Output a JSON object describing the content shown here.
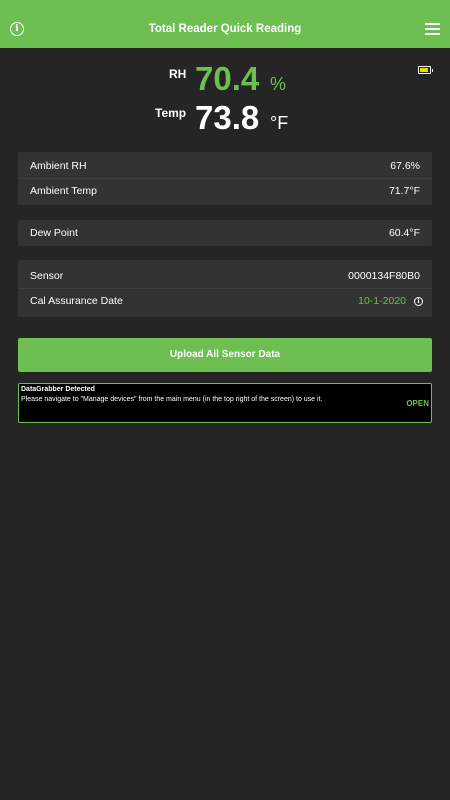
{
  "header": {
    "title": "Total Reader Quick Reading",
    "info_icon": "info-icon",
    "menu_icon": "hamburger-menu-icon"
  },
  "status": {
    "battery_icon": "battery-icon",
    "battery_color": "#e3e000"
  },
  "readings": {
    "rh": {
      "label": "RH",
      "value": "70.4",
      "unit": "%"
    },
    "temp": {
      "label": "Temp",
      "value": "73.8",
      "unit": "°F"
    }
  },
  "ambient": {
    "rh": {
      "label": "Ambient RH",
      "value": "67.6%"
    },
    "temp": {
      "label": "Ambient Temp",
      "value": "71.7°F"
    }
  },
  "dew_point": {
    "label": "Dew Point",
    "value": "60.4°F"
  },
  "sensor": {
    "id": {
      "label": "Sensor",
      "value": "0000134F80B0"
    },
    "cal": {
      "label": "Cal Assurance Date",
      "value": "10-1-2020"
    }
  },
  "actions": {
    "upload_label": "Upload All Sensor Data"
  },
  "notice": {
    "title": "DataGrabber Detected",
    "text": "Please navigate to \"Manage devices\" from the main menu (in the top right of the screen) to use it.",
    "action": "OPEN"
  },
  "colors": {
    "accent": "#6cbf50",
    "background": "#252525",
    "card": "#333333"
  }
}
